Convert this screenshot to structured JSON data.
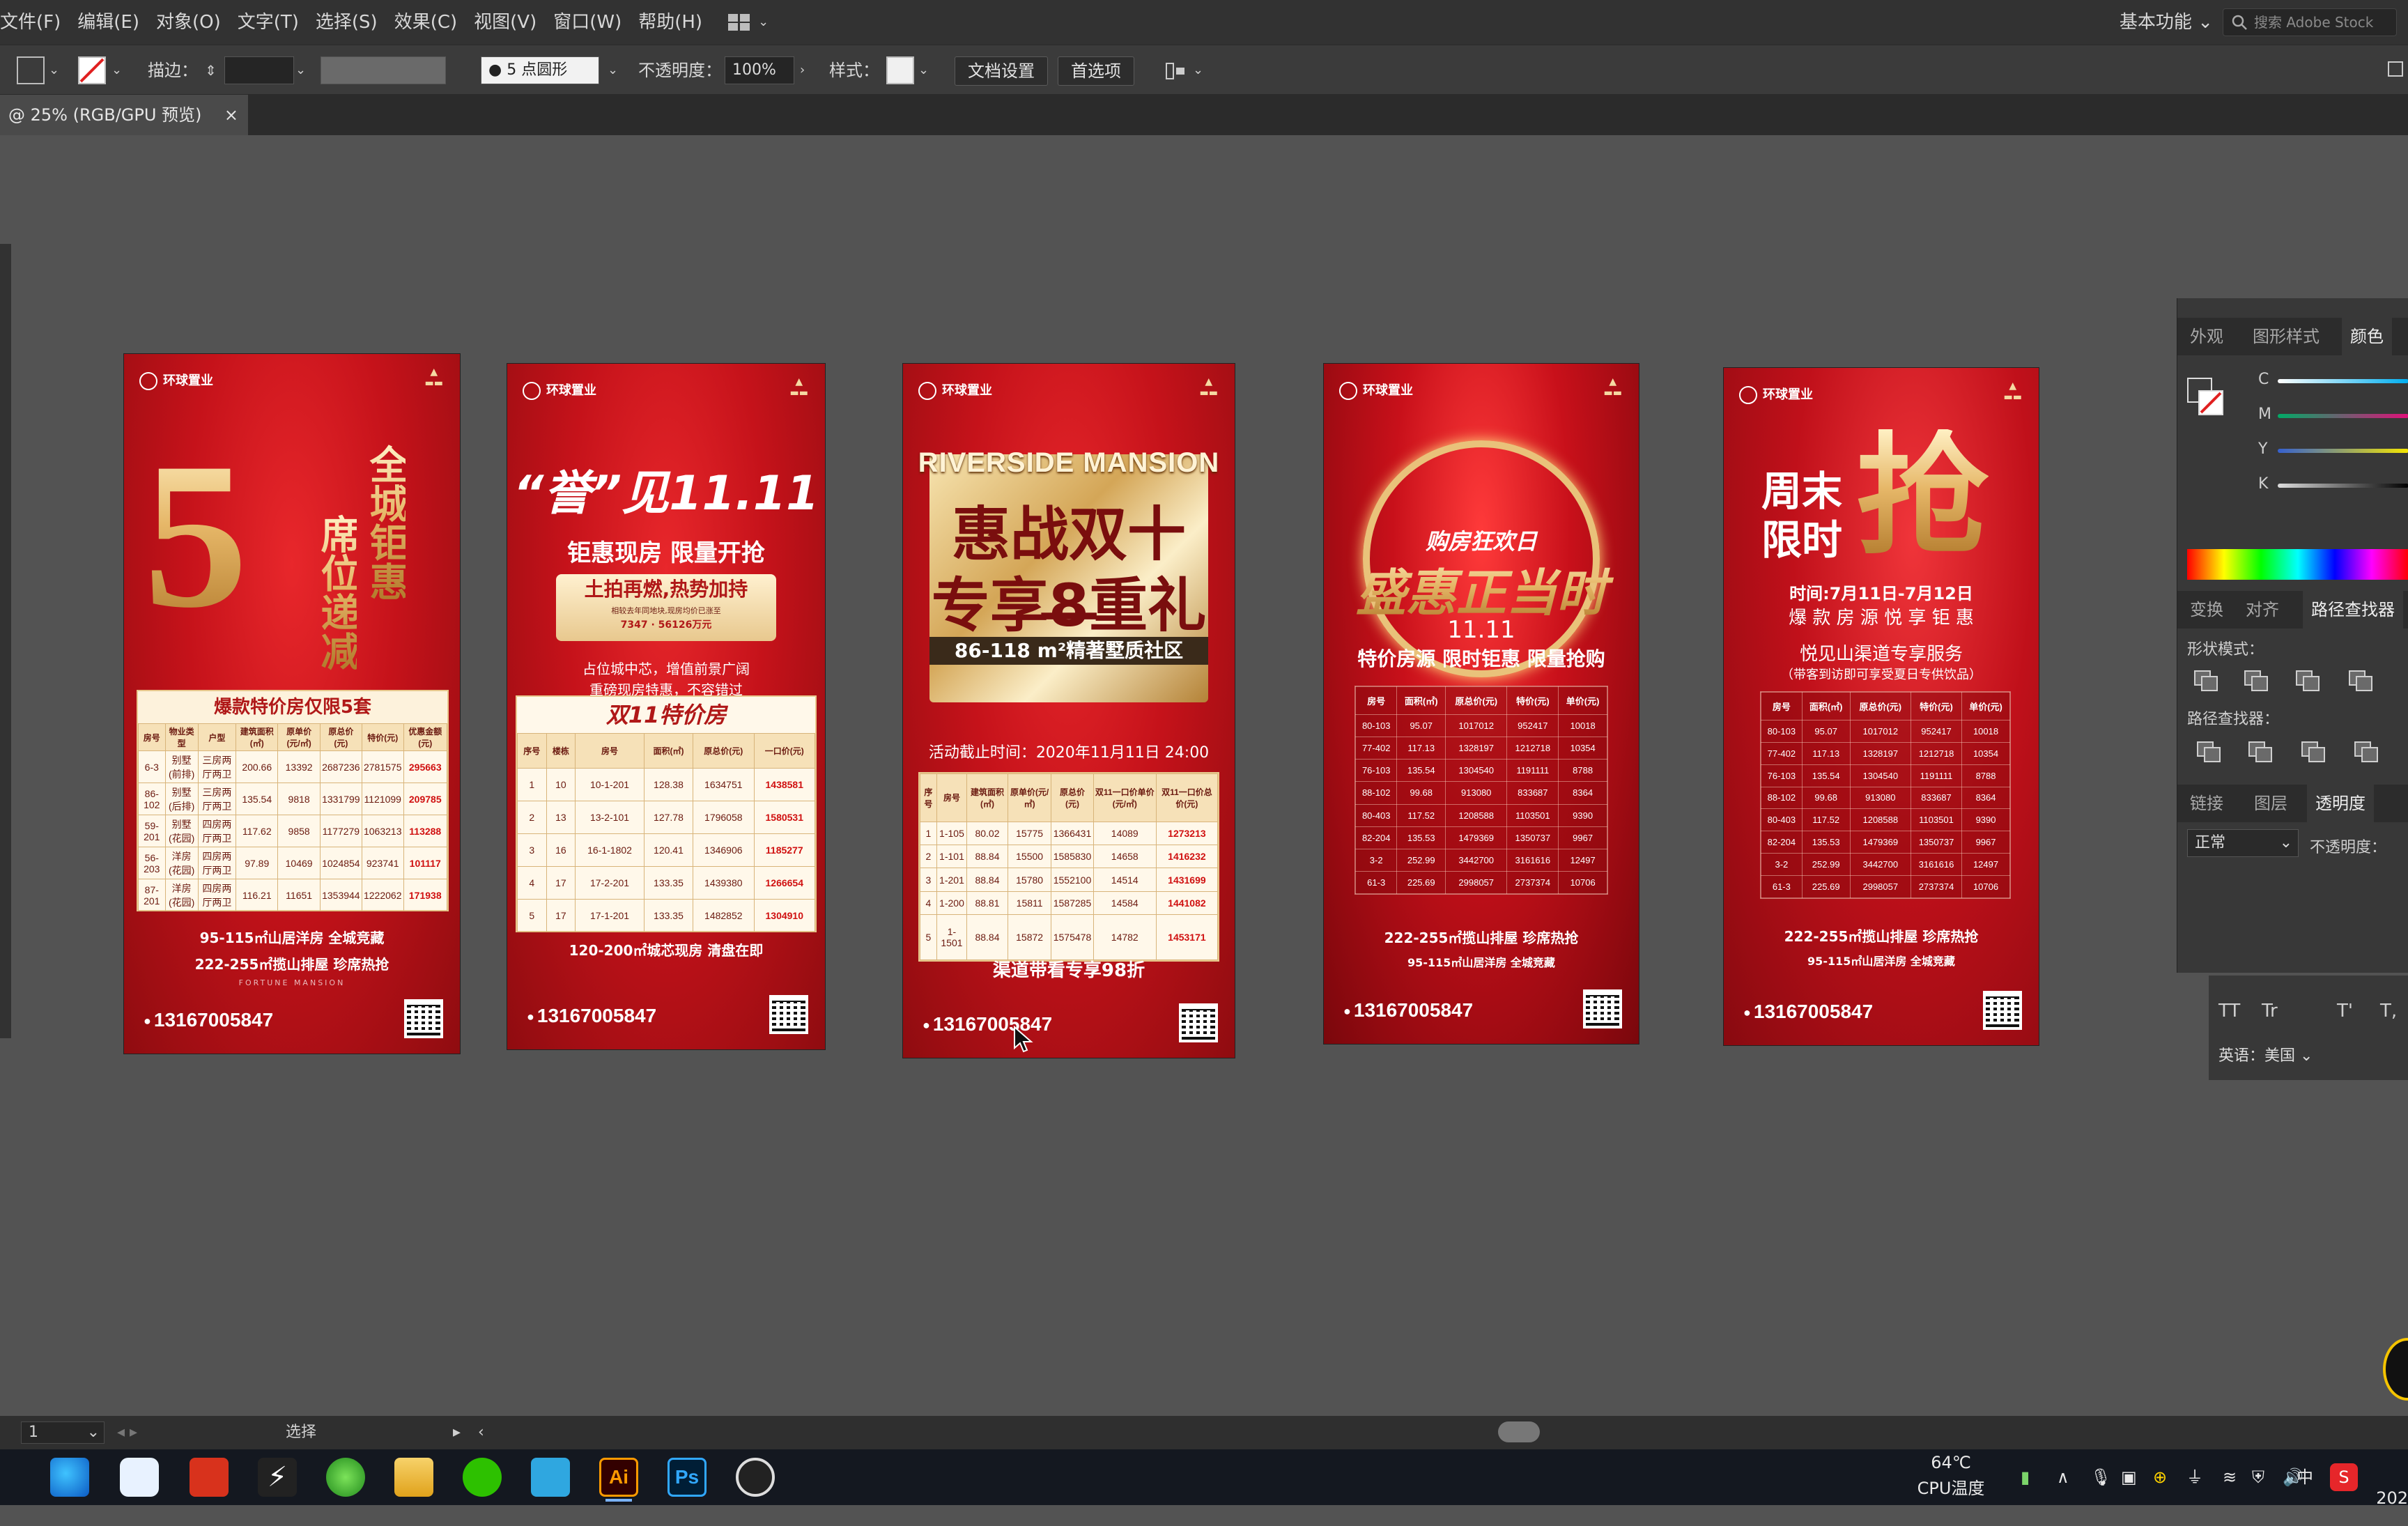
{
  "menu": {
    "items": [
      "文件(F)",
      "编辑(E)",
      "对象(O)",
      "文字(T)",
      "选择(S)",
      "效果(C)",
      "视图(V)",
      "窗口(W)",
      "帮助(H)"
    ],
    "workspace": "基本功能",
    "stock_search_placeholder": "搜索 Adobe Stock"
  },
  "control": {
    "stroke_label": "描边：",
    "brush": "5 点圆形",
    "opacity_label": "不透明度：",
    "opacity_value": "100%",
    "style_label": "样式：",
    "doc_setup": "文档设置",
    "preferences": "首选项"
  },
  "doc_tab": {
    "title": "@ 25% (RGB/GPU 预览)",
    "close": "×"
  },
  "status": {
    "zoom": "1",
    "mode": "选择"
  },
  "artboards": {
    "a1": {
      "vtext_a": "全城钜惠",
      "vtext_b": "席位递减",
      "big": "5",
      "table_title": "爆款特价房仅限5套",
      "headers": [
        "房号",
        "物业类型",
        "户型",
        "建筑面积(㎡)",
        "原单价(元/㎡)",
        "原总价(元)",
        "特价(元)",
        "优惠金额(元)"
      ],
      "rows": [
        [
          "6-3",
          "别墅(前排)",
          "三房两厅两卫",
          "200.66",
          "13392",
          "2687236",
          "2781575",
          "295663"
        ],
        [
          "86-102",
          "别墅(后排)",
          "三房两厅两卫",
          "135.54",
          "9818",
          "1331799",
          "1121099",
          "209785"
        ],
        [
          "59-201",
          "别墅(花园)",
          "四房两厅两卫",
          "117.62",
          "9858",
          "1177279",
          "1063213",
          "113288"
        ],
        [
          "56-203",
          "洋房(花园)",
          "四房两厅两卫",
          "97.89",
          "10469",
          "1024854",
          "923741",
          "101117"
        ],
        [
          "87-201",
          "洋房(花园)",
          "四房两厅两卫",
          "116.21",
          "11651",
          "1353944",
          "1222062",
          "171938"
        ]
      ],
      "foot1": "95-115㎡山居洋房 全城竞藏",
      "foot2": "222-255㎡揽山排屋 珍席热抢",
      "sig": "FORTUNE MANSION",
      "phone": "13167005847"
    },
    "a2": {
      "head": "“誉”见11.11",
      "sub": "钜惠现房 限量开抢",
      "banner": "土拍再燃,热势加持",
      "banner_sub": "相较去年同地块,现房均价已涨至",
      "banner_n1": "7347",
      "banner_n2": "56126万元",
      "desc1": "占位城中芯，增值前景广阔",
      "desc2": "重磅现房特惠，不容错过",
      "table_title": "双11特价房",
      "headers": [
        "序号",
        "楼栋",
        "房号",
        "面积(㎡)",
        "原总价(元)",
        "一口价(元)"
      ],
      "rows": [
        [
          "1",
          "10",
          "10-1-201",
          "128.38",
          "1634751",
          "1438581"
        ],
        [
          "2",
          "13",
          "13-2-101",
          "127.78",
          "1796058",
          "1580531"
        ],
        [
          "3",
          "16",
          "16-1-1802",
          "120.41",
          "1346906",
          "1185277"
        ],
        [
          "4",
          "17",
          "17-2-201",
          "133.35",
          "1439380",
          "1266654"
        ],
        [
          "5",
          "17",
          "17-1-201",
          "133.35",
          "1482852",
          "1304910"
        ]
      ],
      "foot": "120-200㎡城芯现房 清盘在即",
      "phone": "13167005847"
    },
    "a3": {
      "head_en": "RIVERSIDE MANSION",
      "title1": "惠战双十一",
      "title2": "专享8重礼",
      "sub": "86-118 m²精著墅质社区",
      "deadline": "活动截止时间：2020年11月11日 24:00",
      "headers": [
        "序号",
        "房号",
        "建筑面积(㎡)",
        "原单价(元/㎡)",
        "原总价(元)",
        "双11一口价单价(元/㎡)",
        "双11一口价总价(元)"
      ],
      "rows": [
        [
          "1",
          "1-105",
          "80.02",
          "15775",
          "1366431",
          "14089",
          "1273213"
        ],
        [
          "2",
          "1-101",
          "88.84",
          "15500",
          "1585830",
          "14658",
          "1416232"
        ],
        [
          "3",
          "1-201",
          "88.84",
          "15780",
          "1552100",
          "14514",
          "1431699"
        ],
        [
          "4",
          "1-200",
          "88.81",
          "15811",
          "1587285",
          "14584",
          "1441082"
        ],
        [
          "5",
          "1-1501",
          "88.84",
          "15872",
          "1575478",
          "14782",
          "1453171"
        ]
      ],
      "foot": "渠道带看专享98折",
      "phone": "13167005847"
    },
    "a4": {
      "small": "购房狂欢日",
      "title": "盛惠正当时",
      "date": "11.11",
      "sub": "特价房源 限时钜惠 限量抢购",
      "headers": [
        "房号",
        "面积(㎡)",
        "原总价(元)",
        "特价(元)",
        "单价(元)"
      ],
      "rows": [
        [
          "80-103",
          "95.07",
          "1017012",
          "952417",
          "10018"
        ],
        [
          "77-402",
          "117.13",
          "1328197",
          "1212718",
          "10354"
        ],
        [
          "76-103",
          "135.54",
          "1304540",
          "1191111",
          "8788"
        ],
        [
          "88-102",
          "99.68",
          "913080",
          "833687",
          "8364"
        ],
        [
          "80-403",
          "117.52",
          "1208588",
          "1103501",
          "9390"
        ],
        [
          "82-204",
          "135.53",
          "1479369",
          "1350737",
          "9967"
        ],
        [
          "3-2",
          "252.99",
          "3442700",
          "3161616",
          "12497"
        ],
        [
          "61-3",
          "225.69",
          "2998057",
          "2737374",
          "10706"
        ]
      ],
      "foot1": "222-255㎡揽山排屋 珍席热抢",
      "foot2": "95-115㎡山居洋房 全城竞藏",
      "phone": "13167005847"
    },
    "a5": {
      "t1": "周末",
      "t2": "限时",
      "big": "抢",
      "time": "时间:7月11日-7月12日",
      "sub": "爆 款 房 源   悦 享 钜 惠",
      "service": "悦见山渠道专享服务",
      "service_sub": "（带客到访即可享受夏日专供饮品）",
      "headers": [
        "房号",
        "面积(㎡)",
        "原总价(元)",
        "特价(元)",
        "单价(元)"
      ],
      "rows": [
        [
          "80-103",
          "95.07",
          "1017012",
          "952417",
          "10018"
        ],
        [
          "77-402",
          "117.13",
          "1328197",
          "1212718",
          "10354"
        ],
        [
          "76-103",
          "135.54",
          "1304540",
          "1191111",
          "8788"
        ],
        [
          "88-102",
          "99.68",
          "913080",
          "833687",
          "8364"
        ],
        [
          "80-403",
          "117.52",
          "1208588",
          "1103501",
          "9390"
        ],
        [
          "82-204",
          "135.53",
          "1479369",
          "1350737",
          "9967"
        ],
        [
          "3-2",
          "252.99",
          "3442700",
          "3161616",
          "12497"
        ],
        [
          "61-3",
          "225.69",
          "2998057",
          "2737374",
          "10706"
        ]
      ],
      "foot1": "222-255㎡揽山排屋 珍席热抢",
      "foot2": "95-115㎡山居洋房 全城竞藏",
      "phone": "13167005847"
    },
    "logo": "环球置业"
  },
  "panels": {
    "tabs1": [
      "外观",
      "图形样式",
      "颜色"
    ],
    "cmyk": [
      "C",
      "M",
      "Y",
      "K"
    ],
    "tabs2": [
      "变换",
      "对齐",
      "路径查找器"
    ],
    "shape_mode": "形状模式：",
    "pathfinder": "路径查找器：",
    "tabs3": [
      "链接",
      "图层",
      "透明度"
    ],
    "blend": "正常",
    "opacity_label": "不透明度：",
    "language": "英语：美国"
  },
  "taskbar": {
    "temp": "64℃",
    "temp_label": "CPU温度",
    "ime": "中",
    "ai": "Ai",
    "ps": "Ps",
    "year": "202"
  },
  "colors": {
    "accent_red": "#c5121a",
    "gold": "#f6d48f",
    "ui_dark": "#323232",
    "canvas": "#535353"
  }
}
